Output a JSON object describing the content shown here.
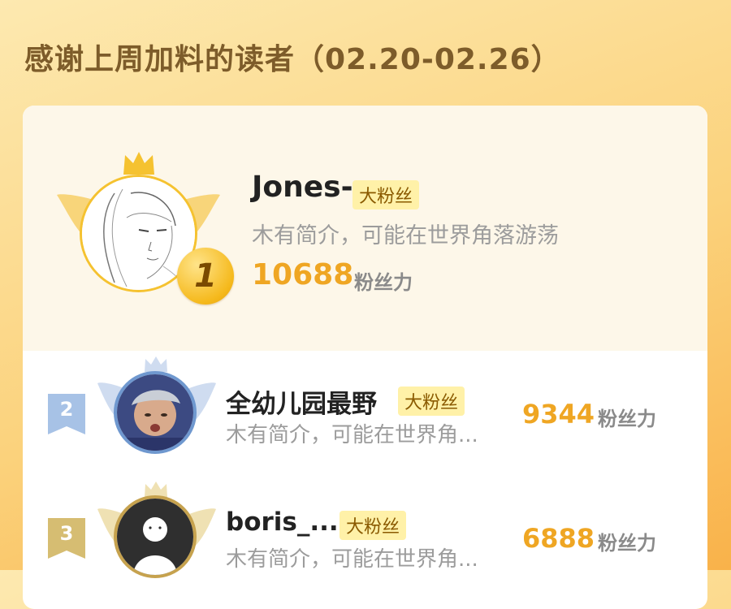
{
  "header": {
    "title": "感谢上周加料的读者（02.20-02.26）"
  },
  "colors": {
    "accent": "#efa623",
    "gold": "#f5b91c",
    "silver": "#9cb8db",
    "bronze": "#c6a24e"
  },
  "ranking": [
    {
      "rank": "1",
      "name": "Jones-",
      "badge": "大粉丝",
      "bio": "木有简介，可能在世界角落游荡",
      "score": "10688",
      "unit": "粉丝力"
    },
    {
      "rank": "2",
      "name": "全幼儿园最野",
      "badge": "大粉丝",
      "bio": "木有简介，可能在世界角...",
      "score": "9344",
      "unit": "粉丝力"
    },
    {
      "rank": "3",
      "name": "boris_...",
      "badge": "大粉丝",
      "bio": "木有简介，可能在世界角...",
      "score": "6888",
      "unit": "粉丝力"
    }
  ]
}
